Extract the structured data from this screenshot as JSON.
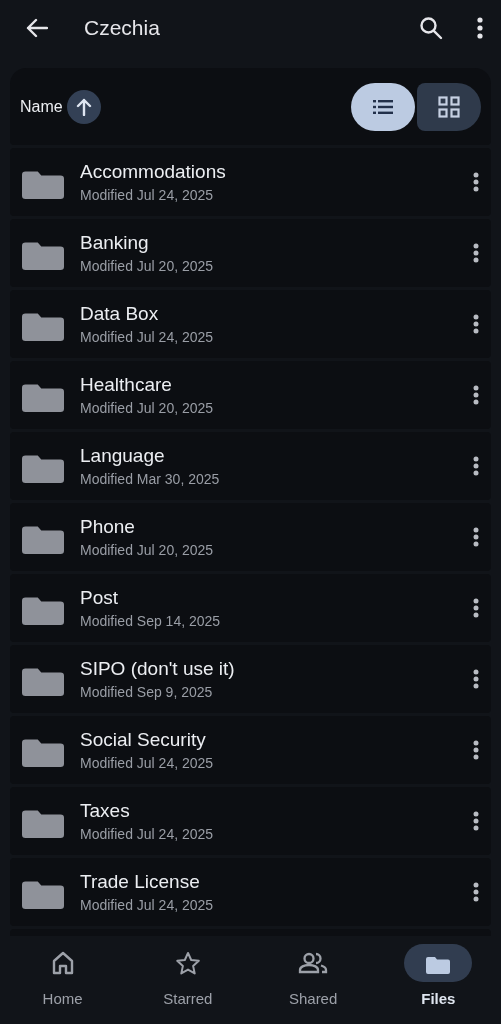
{
  "app_bar": {
    "title": "Czechia"
  },
  "sort": {
    "label": "Name"
  },
  "view_modes": [
    {
      "kind": "list",
      "selected": true
    },
    {
      "kind": "grid",
      "selected": false
    }
  ],
  "folders": [
    {
      "name": "Accommodations",
      "modified": "Modified Jul 24, 2025"
    },
    {
      "name": "Banking",
      "modified": "Modified Jul 20, 2025"
    },
    {
      "name": "Data Box",
      "modified": "Modified Jul 24, 2025"
    },
    {
      "name": "Healthcare",
      "modified": "Modified Jul 20, 2025"
    },
    {
      "name": "Language",
      "modified": "Modified Mar 30, 2025"
    },
    {
      "name": "Phone",
      "modified": "Modified Jul 20, 2025"
    },
    {
      "name": "Post",
      "modified": "Modified Sep 14, 2025"
    },
    {
      "name": "SIPO (don't use it)",
      "modified": "Modified Sep 9, 2025"
    },
    {
      "name": "Social Security",
      "modified": "Modified Jul 24, 2025"
    },
    {
      "name": "Taxes",
      "modified": "Modified Jul 24, 2025"
    },
    {
      "name": "Trade License",
      "modified": "Modified Jul 24, 2025"
    }
  ],
  "bottom_nav": [
    {
      "kind": "home",
      "label": "Home",
      "selected": false
    },
    {
      "kind": "starred",
      "label": "Starred",
      "selected": false
    },
    {
      "kind": "shared",
      "label": "Shared",
      "selected": false
    },
    {
      "kind": "files",
      "label": "Files",
      "selected": true
    }
  ]
}
